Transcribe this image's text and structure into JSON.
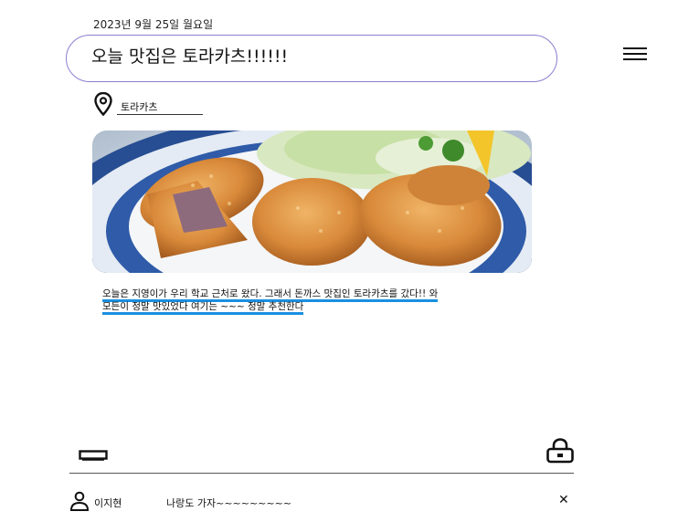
{
  "post": {
    "date": "2023년 9월 25일 월요일",
    "title": "오늘 맛집은 토라카츠!!!!!!",
    "location": "토라카츠",
    "description_line1": "오늘은 지영이가 우리 학교 근처로 왔다. 그래서 돈까스 맛집인 토라카츠를 갔다!! 와",
    "description_line2": "모든이 정말 맛있었다 여기는 ~~~ 정말 추천한다"
  },
  "comments": [
    {
      "author": "이지현",
      "text": "나랑도 가자~~~~~~~~~"
    }
  ],
  "icons": {
    "menu": "menu-icon",
    "pin": "location-pin-icon",
    "comment_input": "comment-input-icon",
    "lock": "unlock-icon",
    "user": "user-icon",
    "close": "close-icon"
  },
  "colors": {
    "title_border": "#8a7fd0",
    "underline": "#1a8fe0"
  }
}
